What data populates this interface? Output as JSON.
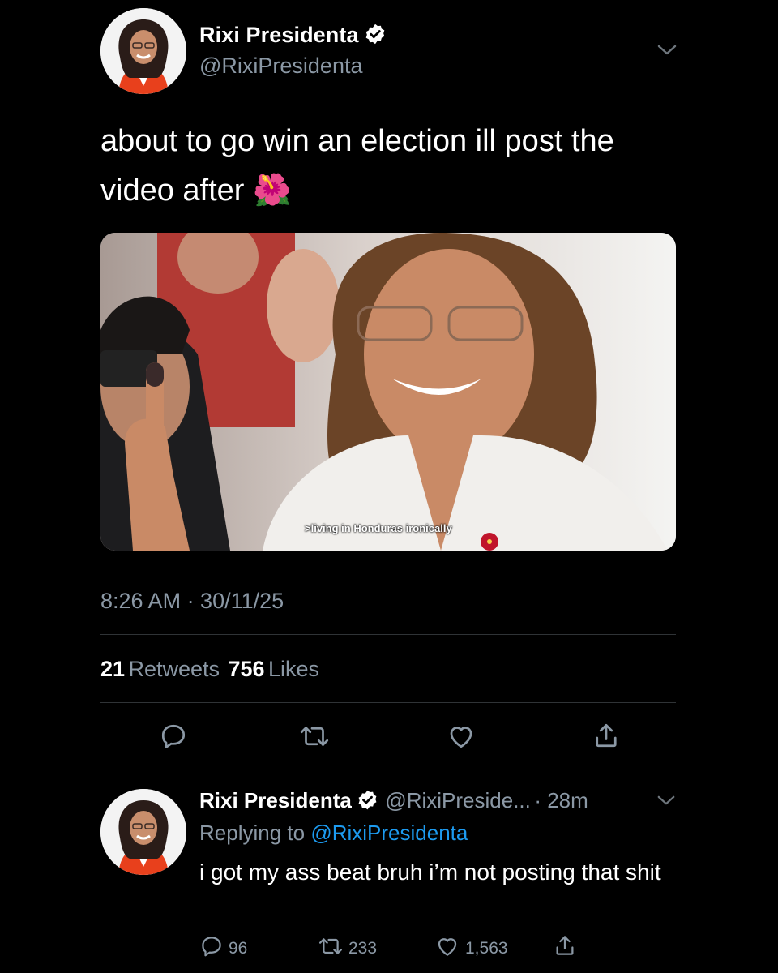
{
  "tweet": {
    "display_name": "Rixi Presidenta",
    "handle": "@RixiPresidenta",
    "verified_icon": "verified-badge-icon",
    "text": "about to go win an election ill post the\nvideo after",
    "emoji": "🌺",
    "image_caption": ">living in Honduras ironically",
    "timestamp": "8:26 AM · 30/11/25",
    "retweets_count": "21",
    "retweets_label": "Retweets",
    "likes_count": "756",
    "likes_label": "Likes",
    "actions": [
      "reply-icon",
      "retweet-icon",
      "like-icon",
      "share-icon"
    ]
  },
  "reply": {
    "display_name": "Rixi Presidenta",
    "handle": "@RixiPreside...",
    "time": "· 28m",
    "replying_prefix": "Replying to",
    "replying_to": "@RixiPresidenta",
    "text": "i got my ass beat bruh i’m not posting that shit",
    "reply_count": "96",
    "retweet_count": "233",
    "like_count": "1,563"
  },
  "colors": {
    "background": "#000000",
    "secondary_text": "#8b98a5",
    "link": "#1d9bf0",
    "divider": "#2f3336"
  }
}
